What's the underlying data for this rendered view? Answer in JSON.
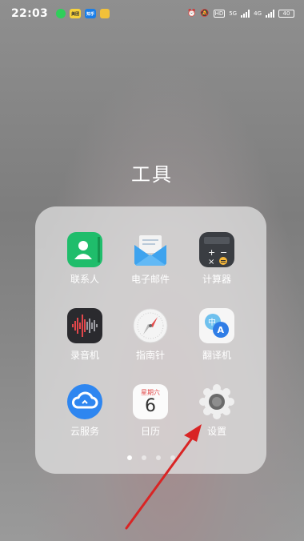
{
  "status_bar": {
    "time": "22:03",
    "notifications": [
      "wechat-icon",
      "app-yellow-icon",
      "zhihu-icon",
      "taobao-icon"
    ],
    "zhihu_text": "知乎",
    "yellow_text": "美团",
    "right": {
      "network1": "5G",
      "network2": "4G",
      "battery": "40"
    }
  },
  "folder": {
    "title": "工具",
    "apps": [
      {
        "name": "contacts",
        "label": "联系人",
        "icon": "contacts-icon"
      },
      {
        "name": "email",
        "label": "电子邮件",
        "icon": "email-icon"
      },
      {
        "name": "calculator",
        "label": "计算器",
        "icon": "calculator-icon"
      },
      {
        "name": "recorder",
        "label": "录音机",
        "icon": "recorder-icon"
      },
      {
        "name": "compass",
        "label": "指南针",
        "icon": "compass-icon"
      },
      {
        "name": "translator",
        "label": "翻译机",
        "icon": "translator-icon"
      },
      {
        "name": "cloud",
        "label": "云服务",
        "icon": "cloud-icon"
      },
      {
        "name": "calendar",
        "label": "日历",
        "icon": "calendar-icon",
        "weekday": "星期六",
        "day": "6"
      },
      {
        "name": "settings",
        "label": "设置",
        "icon": "settings-icon"
      }
    ],
    "page_count": 4,
    "active_page": 1
  },
  "colors": {
    "arrow": "#d92424",
    "contacts": "#1fbd6b",
    "email": "#3ea3ee",
    "cloud": "#2e86f0"
  }
}
